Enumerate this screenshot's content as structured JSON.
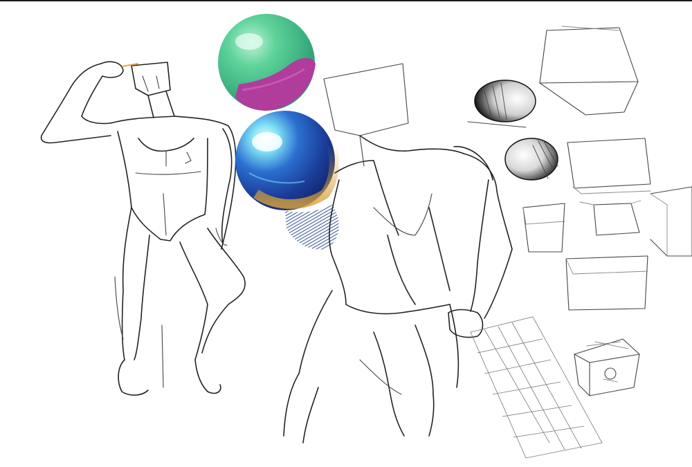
{
  "canvas": {
    "background": "#ffffff",
    "ink_color": "#222222"
  },
  "palette": {
    "green_sphere": "#3fbf8a",
    "magenta_band": "#b03c9c",
    "blue_sphere": "#1f4fae",
    "highlight_cyan": "#bff4ff",
    "gold_rim": "#d9a23a",
    "navy_shadow": "#1c3b86"
  },
  "icons": {
    "green-magenta-sphere": "painted-sphere",
    "blue-sphere": "painted-sphere",
    "cast-shadow": "hatched-shadow",
    "ink-sphere-top": "hatched-sphere",
    "ink-sphere-bottom": "hatched-sphere",
    "perspective-grid": "grid-plane",
    "perspective-boxes": "box-studies",
    "figure-flexing": "figure-sketch",
    "figure-back": "figure-sketch"
  }
}
